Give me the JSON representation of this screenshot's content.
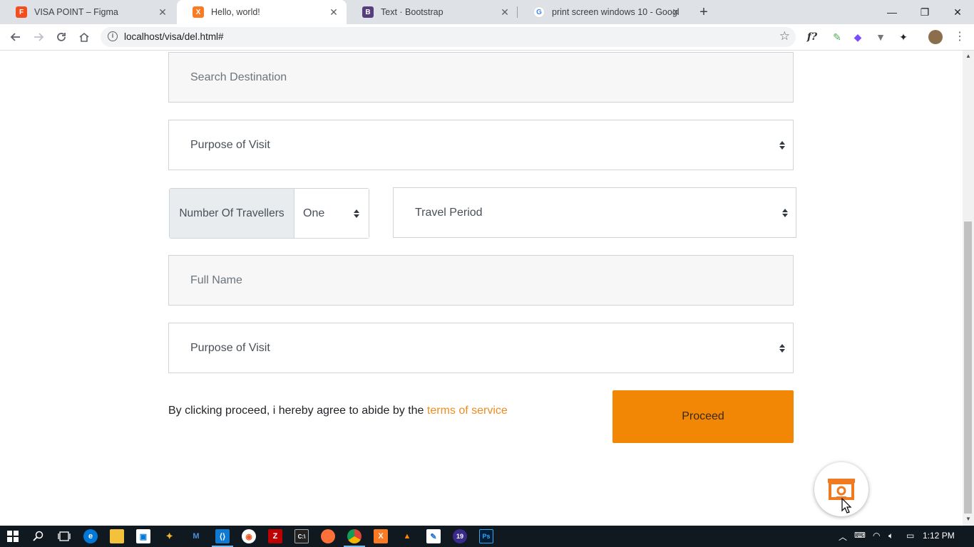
{
  "browser": {
    "tabs": [
      {
        "title": "VISA POINT – Figma",
        "favicon": "figma-icon",
        "color": "#f24e1e"
      },
      {
        "title": "Hello, world!",
        "favicon": "xampp-icon",
        "color": "#fb7a24"
      },
      {
        "title": "Text · Bootstrap",
        "favicon": "bootstrap-icon",
        "color": "#563d7c"
      },
      {
        "title": "print screen windows 10 - Googl",
        "favicon": "google-icon",
        "color": "#4285f4"
      }
    ],
    "url": "localhost/visa/del.html#",
    "tab_close_glyph": "✕",
    "new_tab_glyph": "+",
    "window": {
      "minimize": "—",
      "restore": "❐",
      "close": "✕"
    }
  },
  "form": {
    "search_placeholder": "Search Destination",
    "purpose_select_1": "Purpose of Visit",
    "travellers_label": "Number Of Travellers",
    "travellers_value": "One",
    "travel_period": "Travel Period",
    "full_name_placeholder": "Full Name",
    "purpose_select_2": "Purpose of Visit",
    "agree_prefix": "By clicking proceed, i hereby agree to abide by the ",
    "terms_link": "terms of service",
    "proceed_label": "Proceed"
  },
  "colors": {
    "accent": "#f28705",
    "link": "#ef8c1f",
    "input_bg": "#f7f7f7",
    "addon_bg": "#e9ecef"
  },
  "taskbar": {
    "clock": "1:12 PM"
  }
}
